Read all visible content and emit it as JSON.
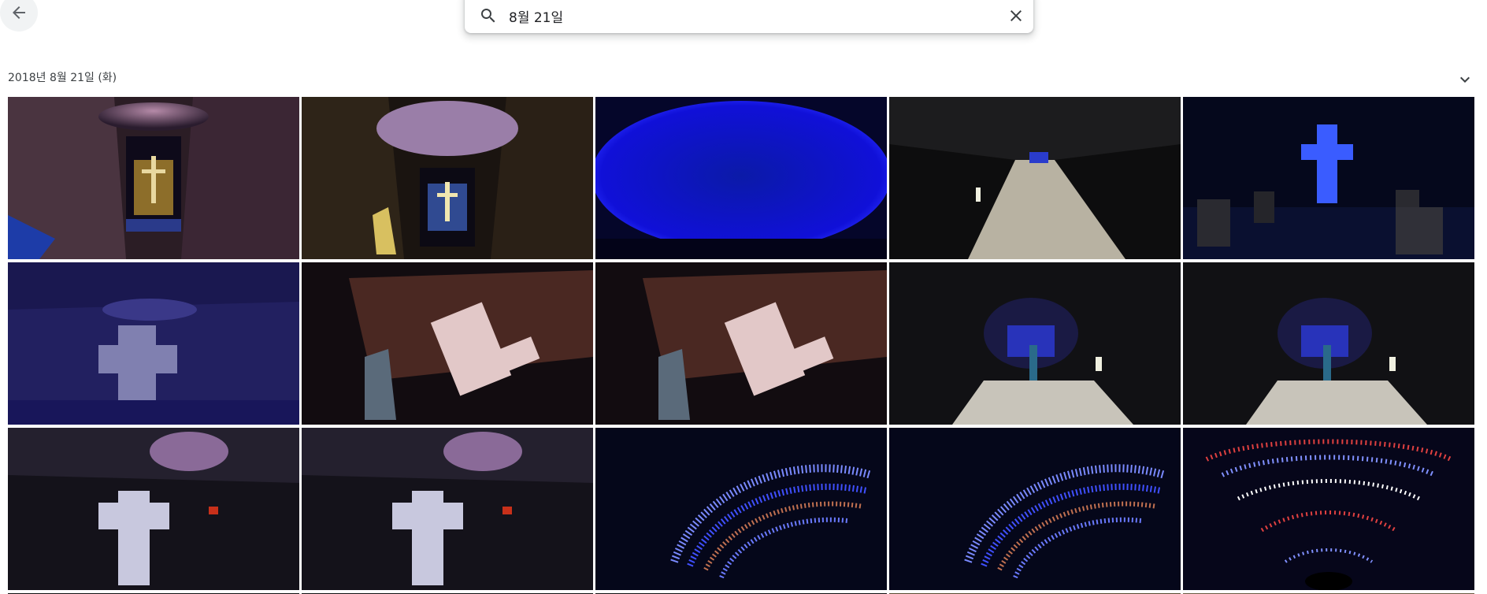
{
  "search": {
    "query": "8월 21일"
  },
  "section": {
    "date_label": "2018년 8월 21일 (화)"
  },
  "icons": {
    "back": "arrow-back-icon",
    "search": "search-icon",
    "clear": "close-icon",
    "collapse": "chevron-down-icon"
  },
  "colors": {
    "accent_blue": "#1a73e8",
    "text": "#202124"
  }
}
